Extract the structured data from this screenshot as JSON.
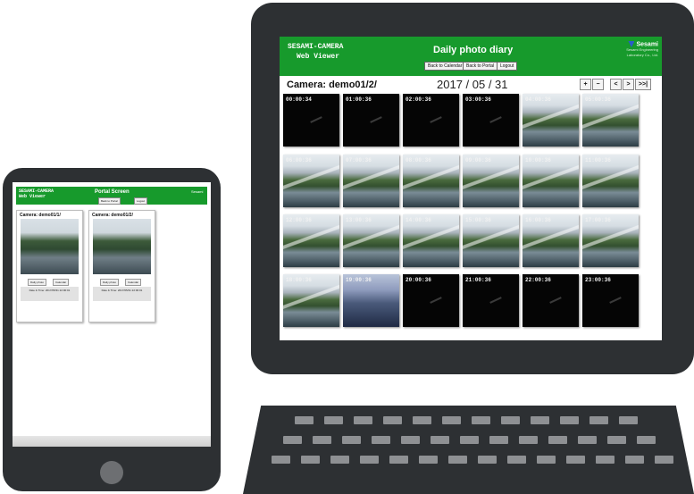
{
  "tablet": {
    "logo_line1": "SESAMI-CAMERA",
    "logo_line2": "Web Viewer",
    "title": "Portal Screen",
    "brand": "Sesami",
    "buttons": [
      "Back to Portal",
      "Logout"
    ],
    "cards": [
      {
        "camera": "Camera: demo01/1/",
        "buttons": [
          "Daily photo",
          "Calendar"
        ],
        "info": "Date & Time: 2017/05/31 22:00:01"
      },
      {
        "camera": "Camera: demo01/2/",
        "buttons": [
          "Daily photo",
          "Calendar"
        ],
        "info": "Date & Time: 2017/05/31 22:00:01"
      }
    ]
  },
  "monitor": {
    "logo_line1": "SESAMI-CAMERA",
    "logo_line2": "Web Viewer",
    "title": "Daily photo diary",
    "buttons": [
      "Back to Calendar",
      "Back to Portal",
      "Logout"
    ],
    "brand": {
      "name": "Sesami",
      "line1": "Sesami Engineering",
      "line2": "Laboratory Co., Ltd."
    },
    "camera_label": "Camera: demo01/2/",
    "date": "2017 / 05 / 31",
    "nav": [
      "+",
      "−",
      "<",
      ">",
      ">>|"
    ],
    "thumbnails": [
      {
        "time": "00:00:34",
        "kind": "dark"
      },
      {
        "time": "01:00:36",
        "kind": "dark"
      },
      {
        "time": "02:00:36",
        "kind": "dark"
      },
      {
        "time": "03:00:36",
        "kind": "dark"
      },
      {
        "time": "04:00:36",
        "kind": "day"
      },
      {
        "time": "05:00:36",
        "kind": "day"
      },
      {
        "time": "06:00:36",
        "kind": "day"
      },
      {
        "time": "07:00:36",
        "kind": "day"
      },
      {
        "time": "08:00:36",
        "kind": "day"
      },
      {
        "time": "09:00:36",
        "kind": "day"
      },
      {
        "time": "10:00:36",
        "kind": "day"
      },
      {
        "time": "11:00:36",
        "kind": "day"
      },
      {
        "time": "12:00:36",
        "kind": "day"
      },
      {
        "time": "13:00:36",
        "kind": "day"
      },
      {
        "time": "14:00:36",
        "kind": "day"
      },
      {
        "time": "15:00:36",
        "kind": "day"
      },
      {
        "time": "16:00:36",
        "kind": "day"
      },
      {
        "time": "17:00:36",
        "kind": "day"
      },
      {
        "time": "18:00:36",
        "kind": "day"
      },
      {
        "time": "19:00:36",
        "kind": "dawn"
      },
      {
        "time": "20:00:36",
        "kind": "dark"
      },
      {
        "time": "21:00:36",
        "kind": "dark"
      },
      {
        "time": "22:00:36",
        "kind": "dark"
      },
      {
        "time": "23:00:36",
        "kind": "dark"
      }
    ]
  },
  "colors": {
    "header_green": "#179a2c",
    "device_body": "#2d3033"
  }
}
